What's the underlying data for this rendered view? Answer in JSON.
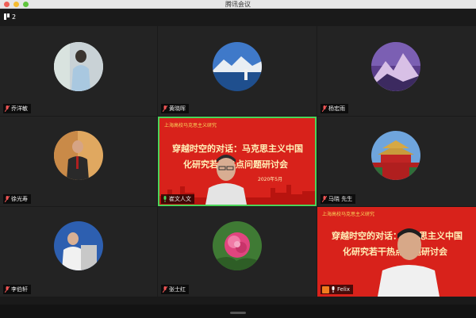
{
  "window": {
    "title": "腾讯会议"
  },
  "toolbar": {
    "participant_count": "2"
  },
  "tiles": [
    {
      "name": "乔洋敏",
      "muted": true
    },
    {
      "name": "黄晓晖",
      "muted": true
    },
    {
      "name": "杨宏雨",
      "muted": true
    },
    {
      "name": "徐光寿",
      "muted": true
    },
    {
      "name": "崔文人文",
      "muted": false,
      "active": true
    },
    {
      "name": "马晓 先生",
      "muted": true
    },
    {
      "name": "李伯轩",
      "muted": true
    },
    {
      "name": "张士红",
      "muted": true
    },
    {
      "name": "Felix",
      "muted": false,
      "host": true
    }
  ],
  "banner": {
    "header": "上海高校马克思主义研究",
    "line1": "穿越时空的对话：马克思主义中国",
    "line2": "化研究若干热点问题研讨会",
    "date": "2020年5月"
  },
  "colors": {
    "banner_red": "#d8221b",
    "active_border": "#4ad45a"
  }
}
